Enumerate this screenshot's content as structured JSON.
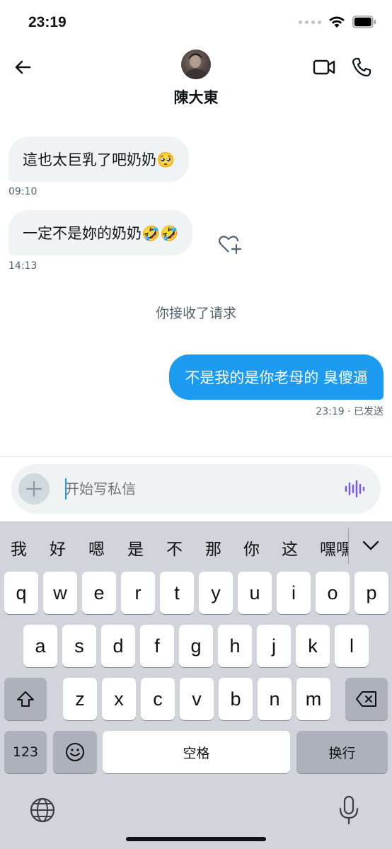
{
  "status_bar": {
    "time": "23:19"
  },
  "header": {
    "contact_name": "陳大東"
  },
  "messages": [
    {
      "text": "這也太巨乳了吧奶奶🥺",
      "time": "09:10"
    },
    {
      "text": "一定不是妳的奶奶🤣🤣",
      "time": "14:13"
    }
  ],
  "system_note": "你接收了请求",
  "outgoing": {
    "text": "不是我的是你老母的 臭傻逼",
    "meta": "23:19 · 已发送"
  },
  "composer": {
    "placeholder": "开始写私信"
  },
  "keyboard": {
    "candidates": [
      "我",
      "好",
      "嗯",
      "是",
      "不",
      "那",
      "你",
      "这"
    ],
    "candidate_partial": "嘿嘿",
    "row1": [
      "q",
      "w",
      "e",
      "r",
      "t",
      "y",
      "u",
      "i",
      "o",
      "p"
    ],
    "row2": [
      "a",
      "s",
      "d",
      "f",
      "g",
      "h",
      "j",
      "k",
      "l"
    ],
    "row3": [
      "z",
      "x",
      "c",
      "v",
      "b",
      "n",
      "m"
    ],
    "numbers_label": "123",
    "space_label": "空格",
    "return_label": "换行"
  },
  "colors": {
    "accent": "#1d9bf0",
    "bubble_in": "#eff3f4",
    "muted_text": "#536471",
    "voice_icon": "#7856ff"
  },
  "icons": [
    "back-arrow-icon",
    "video-call-icon",
    "phone-icon",
    "heart-plus-icon",
    "plus-icon",
    "voice-wave-icon",
    "chevron-down-icon",
    "shift-icon",
    "delete-icon",
    "emoji-icon",
    "globe-icon",
    "microphone-icon"
  ]
}
